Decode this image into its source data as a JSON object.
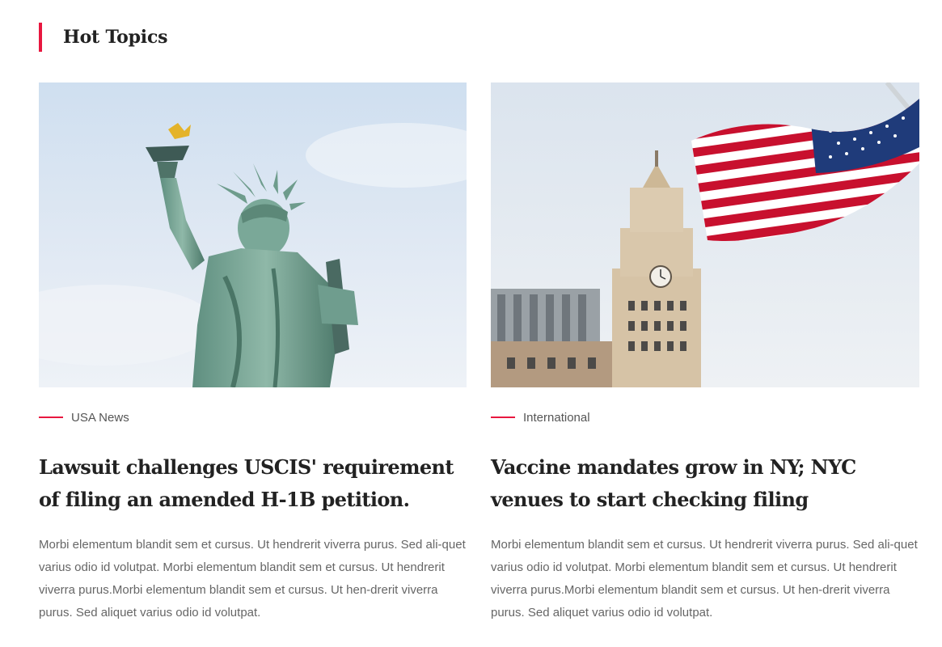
{
  "section": {
    "title": "Hot Topics"
  },
  "cards": [
    {
      "image": "statue-of-liberty-photo",
      "category": "USA News",
      "headline": "Lawsuit challenges USCIS' requirement of filing an amended H-1B petition.",
      "excerpt": "Morbi elementum blandit sem et cursus. Ut hendrerit viverra purus. Sed ali-quet varius odio id volutpat. Morbi elementum blandit sem et cursus. Ut hendrerit viverra purus.Morbi elementum blandit sem et cursus. Ut hen-drerit viverra purus. Sed aliquet varius odio id volutpat."
    },
    {
      "image": "american-flag-clock-tower-photo",
      "category": "International",
      "headline": "Vaccine mandates grow in NY; NYC venues to start checking filing",
      "excerpt": "Morbi elementum blandit sem et cursus. Ut hendrerit viverra purus. Sed ali-quet varius odio id volutpat. Morbi elementum blandit sem et cursus. Ut hendrerit viverra purus.Morbi elementum blandit sem et cursus. Ut hen-drerit viverra purus. Sed aliquet varius odio id volutpat."
    }
  ],
  "colors": {
    "accent": "#e8173f",
    "headline": "#222222",
    "body": "#666666"
  }
}
